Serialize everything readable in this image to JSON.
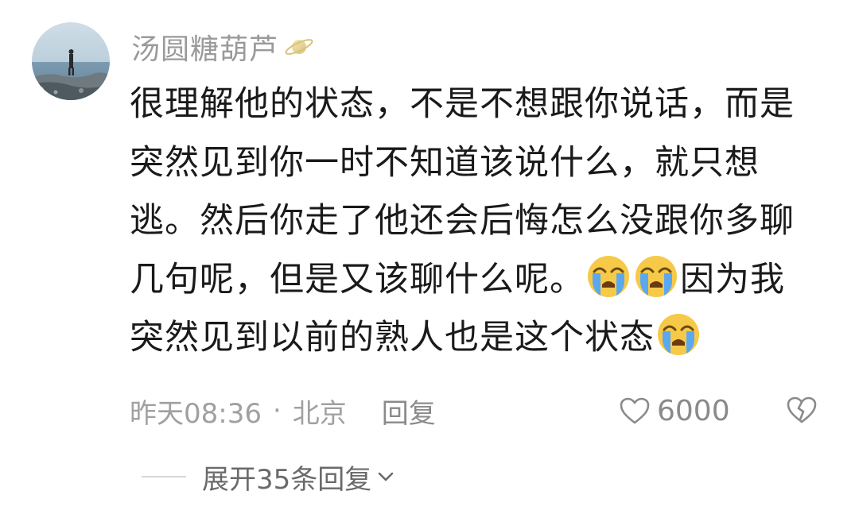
{
  "comment": {
    "author": "汤圆糖葫芦",
    "badge_icon": "planet-badge-icon",
    "content_lines": [
      "很理解他的状态，不是不想跟你说话，而是",
      "突然见到你一时不知道该说什么，就只想",
      "逃。然后你走了他还会后悔怎么没跟你多聊"
    ],
    "line4_text": "几句呢，但是又该聊什么呢。",
    "line4_tail": "因为我",
    "line5_text": "突然见到以前的熟人也是这个状态",
    "emoji": "loudly-crying-face",
    "time": "昨天08:36",
    "separator": "·",
    "location": "北京",
    "reply_label": "回复",
    "like_count": "6000",
    "expand_label": "展开35条回复"
  },
  "colors": {
    "text": "#1a1a1a",
    "meta": "#a0a0a0",
    "emoji_face": "#f7c948",
    "emoji_tears": "#5aa9f0"
  }
}
